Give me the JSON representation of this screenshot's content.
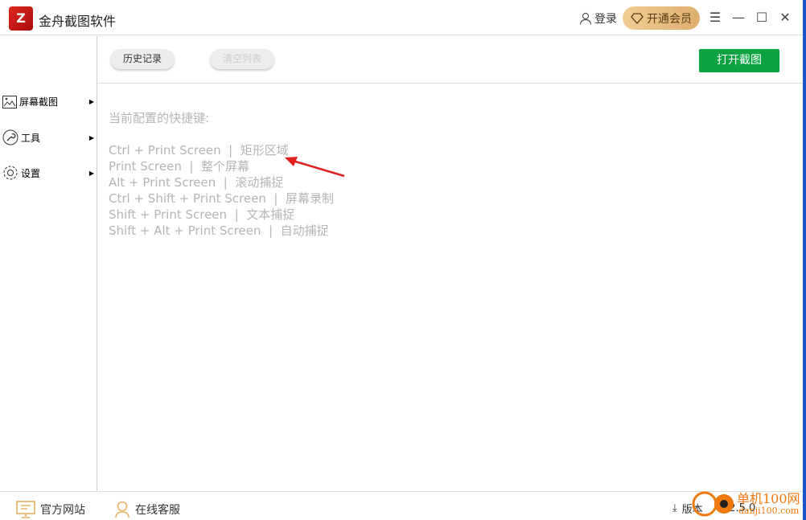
{
  "app": {
    "title": "金舟截图软件",
    "logo_text": "Z"
  },
  "header": {
    "login": "登录",
    "vip": "开通会员"
  },
  "sidebar": {
    "items": [
      {
        "label": "屏幕截图",
        "icon": "image-icon"
      },
      {
        "label": "工具",
        "icon": "wrench-icon"
      },
      {
        "label": "设置",
        "icon": "gear-icon"
      }
    ]
  },
  "toolbar": {
    "history": "历史记录",
    "clear": "清空列表",
    "open": "打开截图"
  },
  "content": {
    "heading": "当前配置的快捷键:",
    "shortcuts": [
      {
        "keys": "Ctrl + Print Screen",
        "action": "矩形区域"
      },
      {
        "keys": "Print Screen",
        "action": "整个屏幕"
      },
      {
        "keys": "Alt + Print Screen",
        "action": "滚动捕捉"
      },
      {
        "keys": "Ctrl + Shift + Print Screen",
        "action": "屏幕录制"
      },
      {
        "keys": "Shift + Print Screen",
        "action": "文本捕捉"
      },
      {
        "keys": "Shift + Alt + Print Screen",
        "action": "自动捕捉"
      }
    ]
  },
  "footer": {
    "website": "官方网站",
    "support": "在线客服",
    "version_label": "版本",
    "version": "3.2.5.0"
  },
  "watermark": {
    "text": "单机100网",
    "url": "danji100.com"
  },
  "colors": {
    "accent_green": "#0aa342",
    "brand_red": "#d81e1e",
    "vip_gold": "#e8bd80",
    "annotation_arrow": "#e02020"
  }
}
